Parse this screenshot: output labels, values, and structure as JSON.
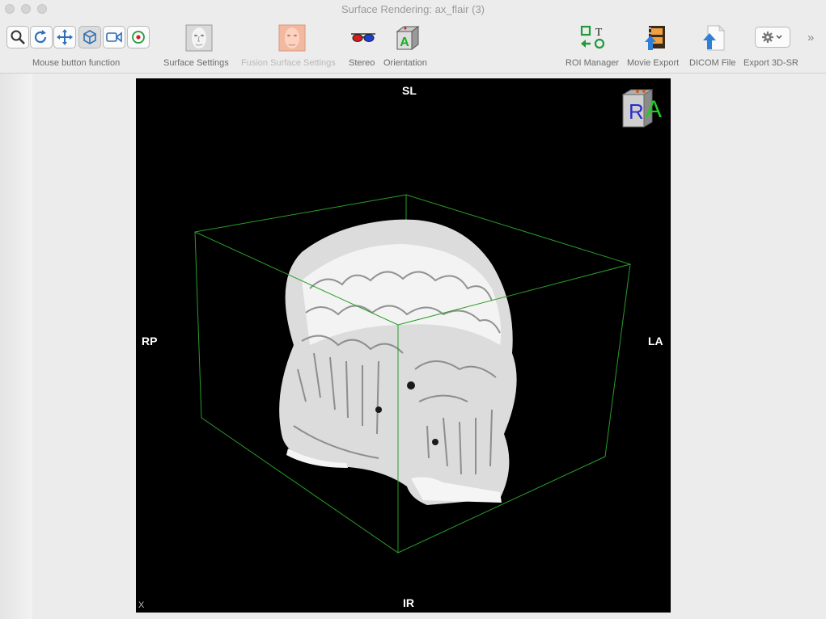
{
  "window": {
    "title": "Surface Rendering: ax_flair (3)"
  },
  "toolbar": {
    "mouse_group_label": "Mouse button function",
    "tools": [
      {
        "name": "zoom-tool",
        "icon": "magnifier-icon"
      },
      {
        "name": "rotate-tool",
        "icon": "rotate-icon"
      },
      {
        "name": "pan-tool",
        "icon": "move-arrows-icon"
      },
      {
        "name": "3d-rotate-tool",
        "icon": "cube-rotate-icon"
      },
      {
        "name": "camera-tool",
        "icon": "video-camera-icon"
      },
      {
        "name": "roi-point-tool",
        "icon": "target-icon"
      }
    ],
    "surface_settings_label": "Surface Settings",
    "fusion_surface_settings_label": "Fusion Surface Settings",
    "stereo_label": "Stereo",
    "orientation_label": "Orientation",
    "roi_manager_label": "ROI Manager",
    "movie_export_label": "Movie Export",
    "dicom_file_label": "DICOM File",
    "export_3dsr_label": "Export 3D-SR",
    "overflow_label": "»",
    "roi_manager_icon_text": "T"
  },
  "viewer": {
    "orientation_top": "SL",
    "orientation_bottom": "IR",
    "orientation_left": "RP",
    "orientation_right": "LA",
    "corner_label": "X",
    "cube_face_front": "A",
    "cube_face_left": "R",
    "bounding_box_color": "#2a9d2a",
    "surface_color": "#e6e6e6"
  }
}
